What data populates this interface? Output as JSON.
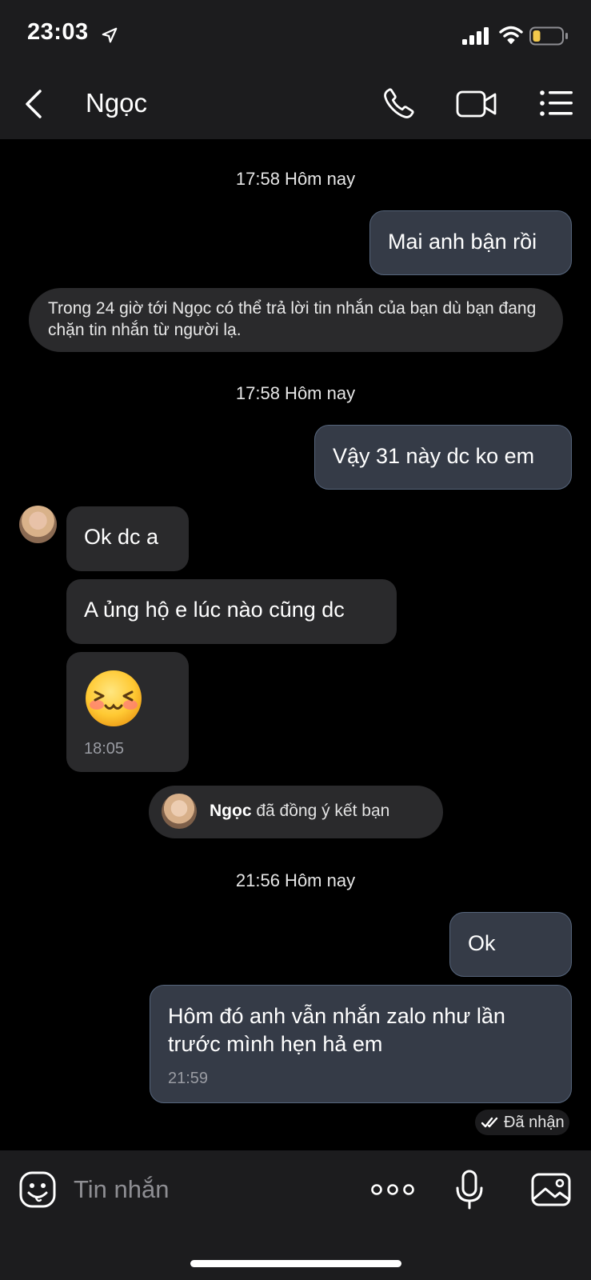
{
  "status_bar": {
    "time": "23:03"
  },
  "header": {
    "title": "Ngọc"
  },
  "messages": [
    {
      "kind": "timestamp",
      "text": "17:58 Hôm nay"
    },
    {
      "kind": "outgoing",
      "text": "Mai anh bận rồi"
    },
    {
      "kind": "notice",
      "text": "Trong 24 giờ tới Ngọc có thể trả lời tin nhắn của bạn dù bạn đang chặn tin nhắn từ người lạ."
    },
    {
      "kind": "timestamp",
      "text": "17:58 Hôm nay"
    },
    {
      "kind": "outgoing",
      "text": "Vậy 31 này dc ko em"
    },
    {
      "kind": "incoming",
      "text": "Ok dc a"
    },
    {
      "kind": "incoming",
      "text": "A ủng hộ e lúc nào cũng dc"
    },
    {
      "kind": "incoming-sticker",
      "sticker": "blushing-smile-emoji",
      "time": "18:05"
    },
    {
      "kind": "system",
      "name": "Ngọc",
      "text": "đã đồng ý kết bạn"
    },
    {
      "kind": "timestamp",
      "text": "21:56 Hôm nay"
    },
    {
      "kind": "outgoing",
      "text": "Ok"
    },
    {
      "kind": "outgoing",
      "text": "Hôm đó anh vẫn nhắn zalo  như lần trước mình hẹn hả em",
      "time": "21:59"
    }
  ],
  "receipt": {
    "text": "Đã nhận"
  },
  "composer": {
    "placeholder": "Tin nhắn"
  },
  "colors": {
    "header_bg": "#1c1c1e",
    "outgoing_bubble": "#353b47",
    "outgoing_border": "#56657c",
    "incoming_bubble": "#2a2a2c",
    "battery_level": "#f2c94c"
  }
}
